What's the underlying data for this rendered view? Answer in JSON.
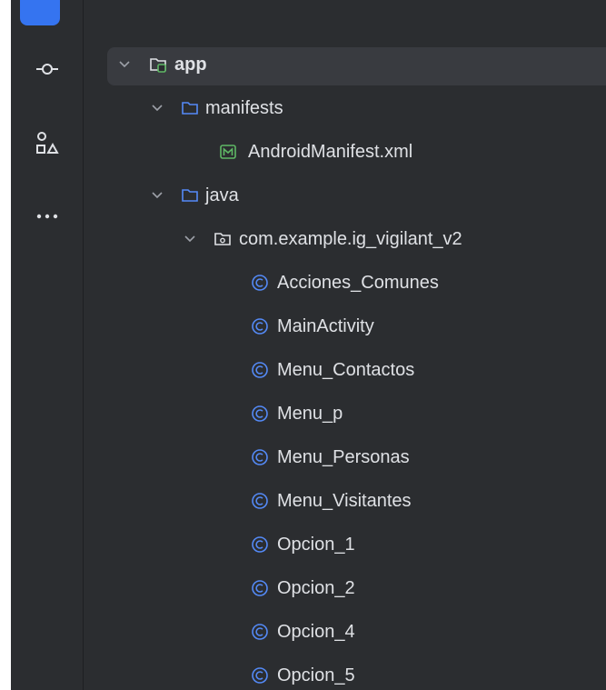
{
  "toolwindow": {
    "buttons": [
      {
        "name": "commit-icon"
      },
      {
        "name": "structure-icon"
      },
      {
        "name": "more-icon"
      }
    ]
  },
  "tree": {
    "root": {
      "label": "app",
      "icon": "module-folder-icon"
    },
    "manifests": {
      "label": "manifests",
      "icon": "folder-icon"
    },
    "manifest_file": {
      "label": "AndroidManifest.xml",
      "icon": "manifest-file-icon"
    },
    "java": {
      "label": "java",
      "icon": "folder-icon"
    },
    "package": {
      "label": "com.example.ig_vigilant_v2",
      "icon": "package-icon"
    },
    "classes": [
      "Acciones_Comunes",
      "MainActivity",
      "Menu_Contactos",
      "Menu_p",
      "Menu_Personas",
      "Menu_Visitantes",
      "Opcion_1",
      "Opcion_2",
      "Opcion_4",
      "Opcion_5"
    ]
  },
  "colors": {
    "background": "#2b2d30",
    "selection": "#393b40",
    "text": "#dfe1e5",
    "folder_accent": "#548af7",
    "manifest_accent": "#5fb865",
    "class_accent": "#548af7",
    "active_tool": "#3574f0"
  }
}
